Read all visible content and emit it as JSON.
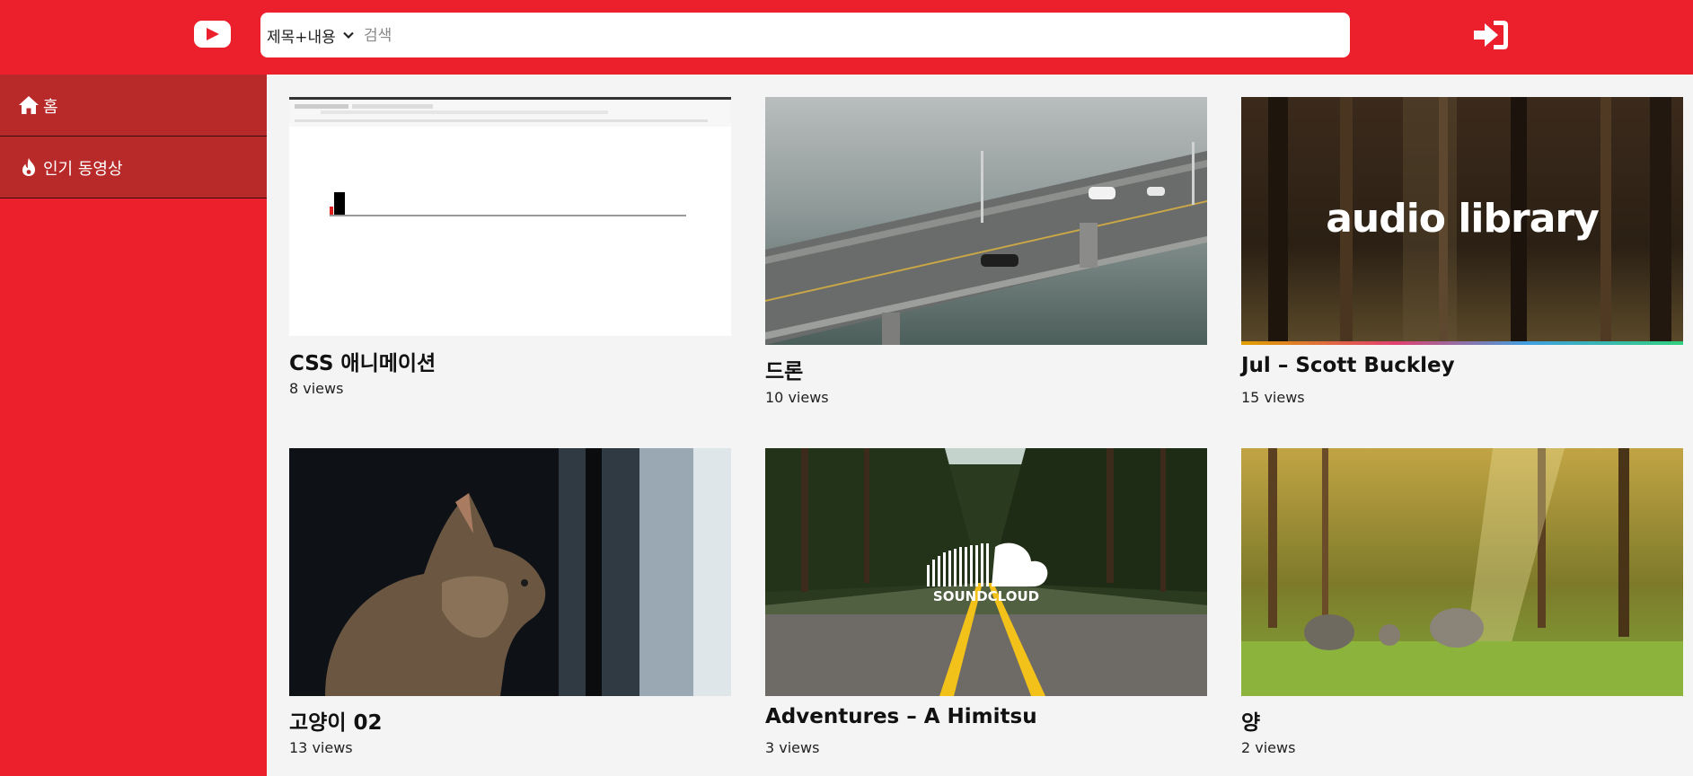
{
  "header": {
    "search_select_label": "제목+내용",
    "search_placeholder": "검색"
  },
  "sidebar": {
    "items": [
      {
        "label": "홈",
        "icon": "home-icon"
      },
      {
        "label": "인기 동영상",
        "icon": "fire-icon"
      }
    ]
  },
  "videos": [
    {
      "title": "CSS 애니메이션",
      "views": "8 views"
    },
    {
      "title": "드론",
      "views": "10 views"
    },
    {
      "title": "Jul – Scott Buckley",
      "views": "15 views",
      "thumb_text": "audio library"
    },
    {
      "title": "고양이 02",
      "views": "13 views"
    },
    {
      "title": "Adventures – A Himitsu",
      "views": "3 views",
      "thumb_text": "SOUNDCLOUD"
    },
    {
      "title": "양",
      "views": "2 views"
    }
  ],
  "colors": {
    "brand_red": "#ec202d",
    "sidebar_item_bg": "#b82a29",
    "content_bg": "#f4f4f4"
  }
}
